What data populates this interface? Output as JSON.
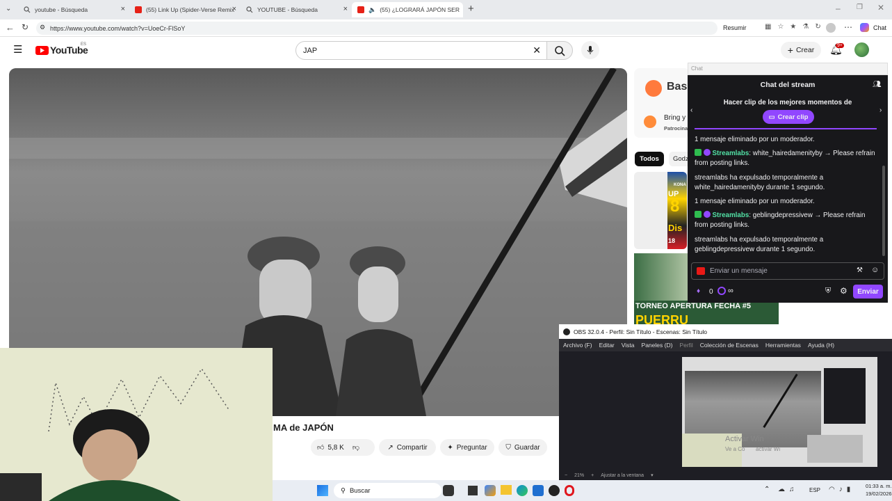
{
  "browser": {
    "tabs": [
      {
        "title": "youtube - Búsqueda",
        "icon": "search-icon"
      },
      {
        "title": "(55) Link Up (Spider-Verse Remix",
        "icon": "youtube-icon"
      },
      {
        "title": "YOUTUBE - Búsqueda",
        "icon": "search-icon"
      },
      {
        "title": "(55) ¿LOGRARÁ JAPÓN SER",
        "icon": "youtube-icon",
        "active": true
      }
    ],
    "url": "https://www.youtube.com/watch?v=UoeCr-FlSoY",
    "resume_label": "Resumir",
    "chat_label": "Chat"
  },
  "youtube": {
    "logo_text": "YouTube",
    "region": "ES",
    "search_value": "JAP",
    "create_label": "Crear",
    "notifications": "9+",
    "video_title_fragment": "MA de JAPÓN",
    "likes": "5,8 K",
    "share_label": "Compartir",
    "ask_label": "Preguntar",
    "save_label": "Guardar",
    "ad_brand": "Bas",
    "ad_text": "Bring y",
    "ad_sponsor": "Patrocina",
    "chips": [
      "Todos",
      "Godz"
    ],
    "thumb_texts": [
      "KONA",
      "UP",
      "8",
      "Dis",
      "18"
    ],
    "thumb2_texts": [
      "TORNEO APERTURA FECHA #5",
      "PUERRU"
    ]
  },
  "chat": {
    "window_label": "Chat",
    "title": "Chat del stream",
    "clip_prompt": "Hacer clip de los mejores momentos de",
    "clip_button": "Crear clip",
    "messages": [
      {
        "text": "1 mensaje eliminado por un moderador."
      },
      {
        "name": "Streamlabs",
        "text": ": white_hairedamenityby → Please refrain from posting links."
      },
      {
        "text": "streamlabs ha expulsado temporalmente a white_hairedamenityby durante 1 segundo."
      },
      {
        "text": "1 mensaje eliminado por un moderador."
      },
      {
        "name": "Streamlabs",
        "text": ": geblingdepressivew → Please refrain from posting links."
      },
      {
        "text": "streamlabs ha expulsado temporalmente a geblingdepressivew durante 1 segundo."
      }
    ],
    "input_placeholder": "Enviar un mensaje",
    "points": "0",
    "infinity": "∞",
    "send_label": "Enviar"
  },
  "obs": {
    "title": "OBS 32.0.4 - Perfil: Sin Título - Escenas: Sin Título",
    "menu": [
      "Archivo (F)",
      "Editar",
      "Vista",
      "Paneles (D)",
      "Perfil",
      "Colección de Escenas",
      "Herramientas",
      "Ayuda (H)"
    ],
    "zoom": "21%",
    "fit_label": "Ajustar a la ventana",
    "watermark": "Activar Win",
    "watermark2": "Ve a Co       activar Wi"
  },
  "taskbar": {
    "search_label": "Buscar",
    "lang": "ESP",
    "time": "01:33 a. m.",
    "date": "19/02/2026"
  },
  "colors": {
    "yt_red": "#ff0000",
    "twitch_purple": "#9147ff",
    "chat_bg": "#18181b",
    "streamlabs_green": "#52e0a5"
  }
}
